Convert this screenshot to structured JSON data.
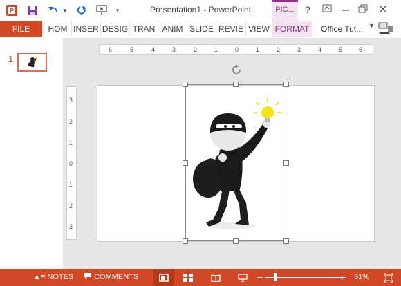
{
  "window": {
    "title": "Presentation1 - PowerPoint",
    "context_tab": "PIC...",
    "help": "?"
  },
  "ribbon": {
    "file": "FILE",
    "tabs": [
      "HOM",
      "INSER",
      "DESIG",
      "TRAN",
      "ANIM",
      "SLIDE",
      "REVIE",
      "VIEW",
      "FORMAT"
    ],
    "account": "Office Tut..."
  },
  "slides_pane": {
    "slide_number": "1"
  },
  "rulers": {
    "horizontal": [
      "6",
      "5",
      "4",
      "3",
      "2",
      "1",
      "0",
      "1",
      "2",
      "3",
      "4",
      "5",
      "6"
    ],
    "vertical": [
      "3",
      "2",
      "1",
      "0",
      "1",
      "2",
      "3"
    ]
  },
  "status_bar": {
    "notes": "NOTES",
    "comments": "COMMENTS",
    "zoom": "31%",
    "zoom_level": 0.31,
    "zoom_minus": "−",
    "zoom_plus": "+"
  },
  "colors": {
    "accent": "#d24726",
    "format_tab": "#9c2f8d"
  }
}
